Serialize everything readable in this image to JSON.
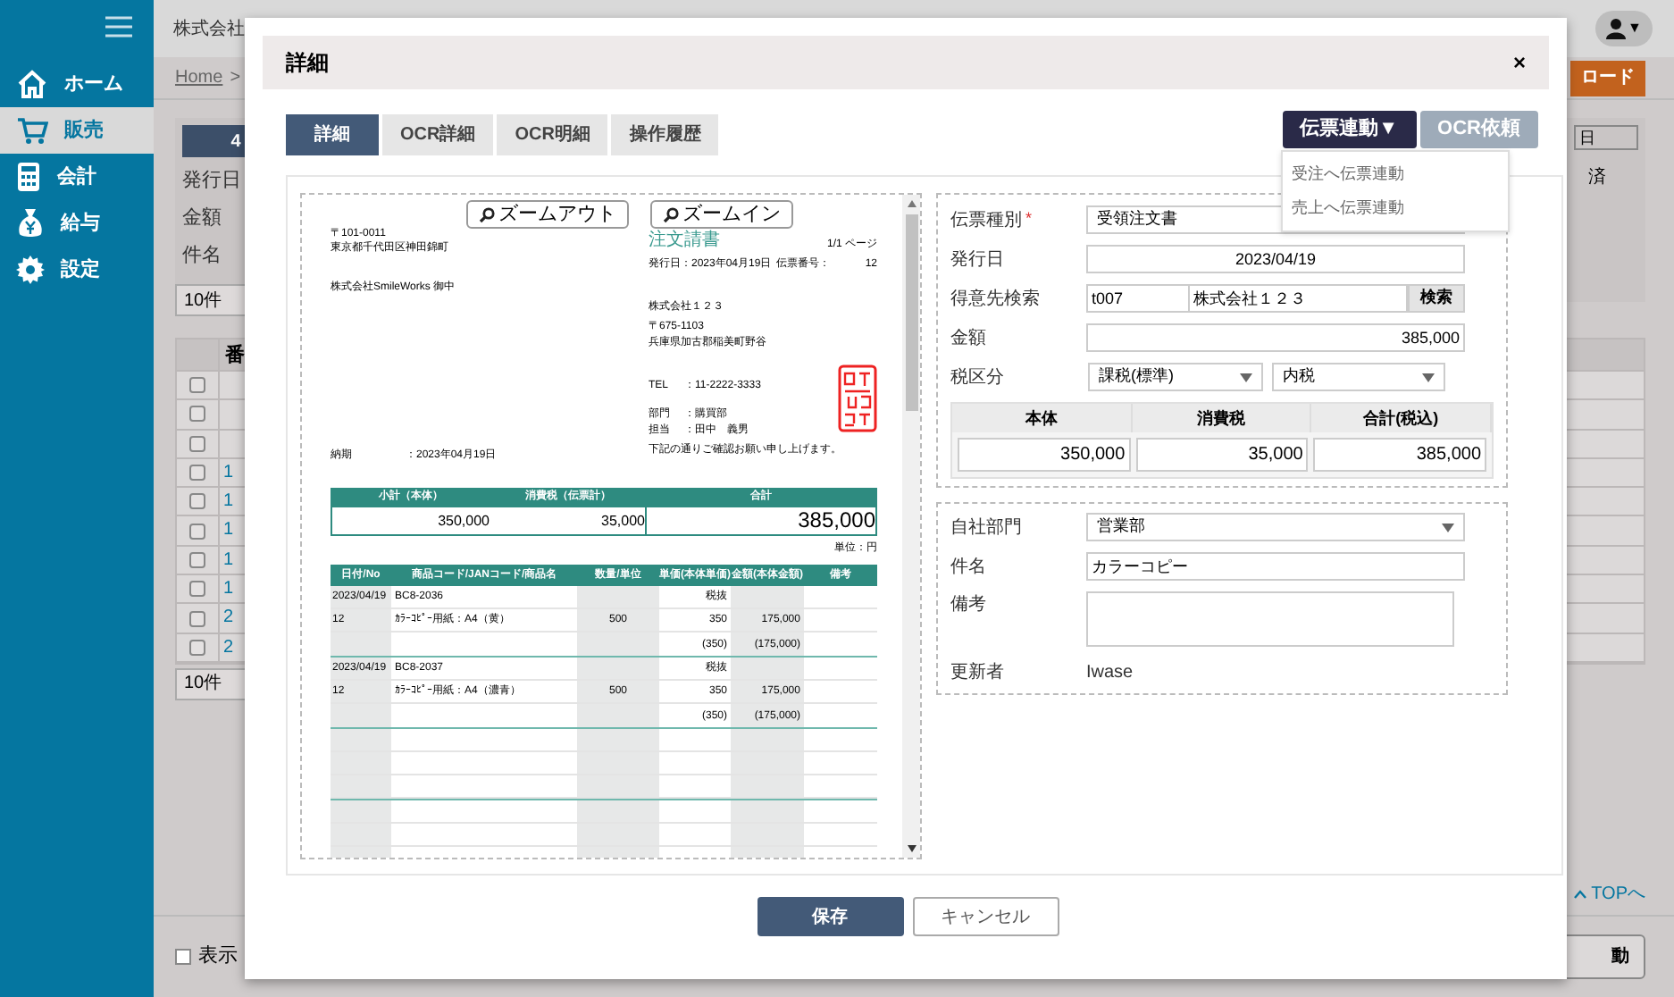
{
  "sidebar": {
    "items": [
      {
        "label": "ホーム",
        "selected": false
      },
      {
        "label": "販売",
        "selected": true
      },
      {
        "label": "会計",
        "selected": false
      },
      {
        "label": "給与",
        "selected": false
      },
      {
        "label": "設定",
        "selected": false
      }
    ]
  },
  "header": {
    "company": "株式会社",
    "user_caret": "▼"
  },
  "breadcrumb": {
    "home": "Home",
    "separator": ">"
  },
  "download_button": "ロード",
  "filter_panel": {
    "banner": "4",
    "labels": [
      "発行日",
      "金額",
      "件名"
    ],
    "column_label": "日",
    "status": "済"
  },
  "page_size_selects": [
    "10件",
    "10件"
  ],
  "list_table": {
    "header": "番",
    "rows": [
      {
        "checked": false
      },
      {
        "checked": false
      },
      {
        "checked": false
      },
      {
        "checked": false,
        "number": "1"
      },
      {
        "checked": false,
        "number": "1"
      },
      {
        "checked": false,
        "number": "1"
      },
      {
        "checked": false,
        "number": "1"
      },
      {
        "checked": false,
        "number": "1"
      },
      {
        "checked": false,
        "number": "2"
      },
      {
        "checked": false,
        "number": "2"
      }
    ]
  },
  "top_link": "TOPへ",
  "footer": {
    "checkbox": {
      "label": "表示",
      "checked": false
    },
    "action_button": "動"
  },
  "modal": {
    "title": "詳細",
    "close": "×",
    "tabs": [
      {
        "label": "詳細",
        "selected": true
      },
      {
        "label": "OCR詳細",
        "selected": false
      },
      {
        "label": "OCR明細",
        "selected": false
      },
      {
        "label": "操作履歴",
        "selected": false
      }
    ],
    "actions": [
      {
        "label": "伝票連動▼",
        "disabled": false
      },
      {
        "label": "OCR依頼",
        "disabled": true
      }
    ],
    "action_menu": [
      "受注へ伝票連動",
      "売上へ伝票連動"
    ],
    "document": {
      "zoom_buttons": [
        "ズームアウト",
        "ズームイン"
      ],
      "sender": [
        "〒101-0011",
        "東京都千代田区神田錦町"
      ],
      "recipient": "株式会社SmileWorks 御中",
      "title": "注文請書",
      "page": "1/1 ページ",
      "issue_date": "発行日：2023年04月19日",
      "slip_label": "伝票番号：",
      "slip_no": "12",
      "issuer": [
        "株式会社１２３",
        "〒675-1103",
        "兵庫県加古郡稲美町野谷"
      ],
      "contacts": [
        {
          "label": "TEL",
          "value": "：11-2222-3333"
        },
        {
          "label": "部門",
          "value": "：購買部"
        },
        {
          "label": "担当",
          "value": "：田中　義男"
        }
      ],
      "delivery_label": "納期",
      "delivery": "：2023年04月19日",
      "note": "下記の通りご確認お願い申し上げます。",
      "totals": {
        "columns": [
          "小計（本体）",
          "消費税（伝票計）",
          "合計"
        ],
        "values": [
          "350,000",
          "35,000",
          "385,000"
        ]
      },
      "unit": "単位：円",
      "items": {
        "columns": [
          "日付/No",
          "商品コード/JANコード/商品名",
          "数量/単位",
          "単価(本体単価)",
          "金額(本体金額)",
          "備考"
        ],
        "rows": [
          {
            "date": "2023/04/19",
            "code": "BC8-2036",
            "tax": "税抜",
            "no": "12",
            "name": "ｶﾗｰｺﾋﾟｰ用紙：A4（黄）",
            "qty": "500",
            "price": "350",
            "amount": "175,000",
            "price_sub": "(350)",
            "amount_sub": "(175,000)"
          },
          {
            "date": "2023/04/19",
            "code": "BC8-2037",
            "tax": "税抜",
            "no": "12",
            "name": "ｶﾗｰｺﾋﾟｰ用紙：A4（濃青）",
            "qty": "500",
            "price": "350",
            "amount": "175,000",
            "price_sub": "(350)",
            "amount_sub": "(175,000)"
          }
        ]
      }
    },
    "form": {
      "slip_type": {
        "label": "伝票種別",
        "required_mark": "*",
        "value": "受領注文書"
      },
      "issue_date": {
        "label": "発行日",
        "value": "2023/04/19"
      },
      "customer": {
        "label": "得意先検索",
        "code": "t007",
        "name": "株式会社１２３",
        "button": "検索"
      },
      "amount": {
        "label": "金額",
        "value": "385,000"
      },
      "tax": {
        "label": "税区分",
        "category": "課税(標準)",
        "method": "内税"
      },
      "breakdown": {
        "columns": [
          "本体",
          "消費税",
          "合計(税込)"
        ],
        "values": [
          "350,000",
          "35,000",
          "385,000"
        ]
      },
      "department": {
        "label": "自社部門",
        "value": "営業部"
      },
      "subject": {
        "label": "件名",
        "value": "カラーコピー"
      },
      "remarks": {
        "label": "備考"
      },
      "updated_by": {
        "label": "更新者",
        "value": "Iwase"
      }
    },
    "buttons": [
      {
        "label": "保存",
        "kind": "primary"
      },
      {
        "label": "キャンセル",
        "kind": "secondary"
      }
    ]
  }
}
